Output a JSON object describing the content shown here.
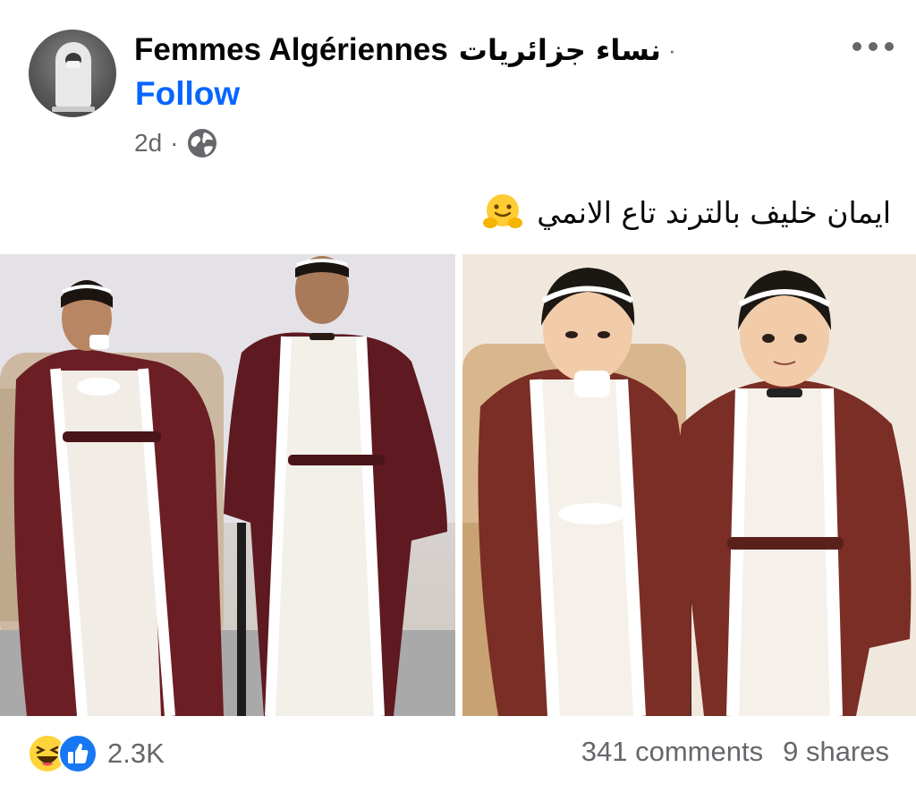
{
  "post": {
    "page_name": "Femmes Algériennes",
    "page_name_arabic": "نساء جزائريات",
    "separator": "·",
    "follow_label": "Follow",
    "time": "2d",
    "meta_dot": "·",
    "privacy_icon": "globe-icon",
    "more_icon": "more-horizontal-icon",
    "text_arabic": "ايمان خليف بالترند تاع الانمي",
    "text_emoji": "hugging-face-emoji"
  },
  "media": {
    "images": [
      {
        "name": "photo-left",
        "kind": "photo"
      },
      {
        "name": "photo-right",
        "kind": "anime-illustration"
      }
    ]
  },
  "footer": {
    "reaction_icons": [
      "haha-reaction-icon",
      "like-reaction-icon"
    ],
    "reaction_count": "2.3K",
    "comments": "341 comments",
    "shares": "9 shares"
  },
  "colors": {
    "follow_blue": "#0866ff",
    "secondary_text": "#65676b",
    "robe_burgundy": "#6b1e24",
    "robe_anime_brown": "#7a2e25"
  }
}
